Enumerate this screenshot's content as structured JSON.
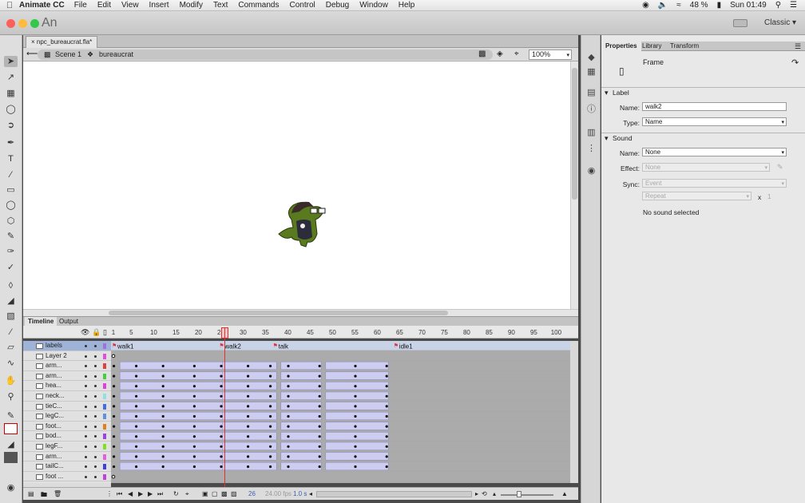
{
  "menubar": {
    "app": "Animate CC",
    "items": [
      "File",
      "Edit",
      "View",
      "Insert",
      "Modify",
      "Text",
      "Commands",
      "Control",
      "Debug",
      "Window",
      "Help"
    ],
    "battery": "48 %",
    "clock": "Sun 01:49"
  },
  "app_logo": "An",
  "workspace": "Classic",
  "document": {
    "tab": "npc_bureaucrat.fla*",
    "breadcrumb": [
      "Scene 1",
      "bureaucrat"
    ],
    "zoom": "100%"
  },
  "timeline": {
    "tabs": [
      "Timeline",
      "Output"
    ],
    "ruler": [
      "1",
      "5",
      "10",
      "15",
      "20",
      "25",
      "30",
      "35",
      "40",
      "45",
      "50",
      "55",
      "60",
      "65",
      "70",
      "75",
      "80",
      "85",
      "90",
      "95",
      "100"
    ],
    "current_frame_label": "25",
    "layers": [
      "labels",
      "Layer 2",
      "arm...",
      "arm...",
      "hea...",
      "neck...",
      "tieC...",
      "legC...",
      "foot...",
      "bod...",
      "legF...",
      "arm...",
      "tailC...",
      "foot ..."
    ],
    "frame_labels": [
      "walk1",
      "walk2",
      "talk",
      "idle1"
    ],
    "footer": {
      "current_frame": "26",
      "fps": "24.00 fps",
      "time": "1.0 s"
    }
  },
  "properties": {
    "tabs": [
      "Properties",
      "Library",
      "Transform"
    ],
    "object_type": "Frame",
    "label_section": "Label",
    "label_name_label": "Name:",
    "label_name_value": "walk2",
    "label_type_label": "Type:",
    "label_type_value": "Name",
    "sound_section": "Sound",
    "sound_name_label": "Name:",
    "sound_name_value": "None",
    "effect_label": "Effect:",
    "effect_value": "None",
    "sync_label": "Sync:",
    "sync_value": "Event",
    "repeat_value": "Repeat",
    "repeat_x": "x",
    "repeat_count": "1",
    "no_sound": "No sound selected"
  }
}
